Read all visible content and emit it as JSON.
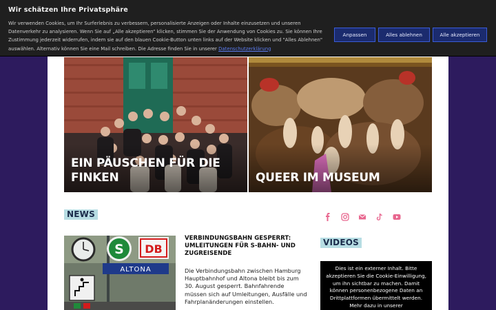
{
  "cookie_banner": {
    "title": "Wir schätzen Ihre Privatsphäre",
    "text": "Wir verwenden Cookies, um Ihr Surferlebnis zu verbessern, personalisierte Anzeigen oder Inhalte einzusetzen und unseren Datenverkehr zu analysieren. Wenn Sie auf „Alle akzeptieren“ klicken, stimmen Sie der Anwendung von Cookies zu. Sie können Ihre Zustimmung jederzeit widerrufen, indem sie auf den blauen Cookie-Button unten links auf der Website klicken und \"Alles Ablehnen\" auswählen. Alternativ können Sie eine Mail schreiben. Die Adresse finden Sie in unserer",
    "privacy_link": "Datenschutzerklärung",
    "buttons": {
      "customize": "Anpassen",
      "reject_all": "Alles ablehnen",
      "accept_all": "Alle akzeptieren"
    },
    "button_color": "#1b2b6e"
  },
  "hero": [
    {
      "title": "EIN PÄUSCHEN FÜR DIE FINKEN"
    },
    {
      "title": "QUEER IM MUSEUM"
    }
  ],
  "sections": {
    "news_label": "NEWS",
    "videos_label": "VIDEOS"
  },
  "social_icons": [
    "facebook-icon",
    "instagram-icon",
    "mail-icon",
    "tiktok-icon",
    "youtube-icon"
  ],
  "social_color": "#e8678f",
  "news": {
    "headline": "VERBINDUNGSBAHN GESPERRT: UMLEITUNGEN FÜR S-BAHN- UND ZUGREISENDE",
    "text": "Die Verbindungsbahn zwischen Hamburg Hauptbahnhof und Altona bleibt bis zum 30. August gesperrt. Bahnfahrende müssen sich auf Umleitungen, Ausfälle und Fahrplanänderungen einstellen.",
    "image_signs": {
      "s_bahn": "S",
      "db": "DB",
      "station": "ALTONA"
    }
  },
  "video_notice": "Dies ist ein externer Inhalt. Bitte akzeptieren Sie die Cookie-Einwilligung, um ihn sichtbar zu machen. Damit können personenbezogene Daten an Drittplattformen übermittelt werden. Mehr dazu in unserer",
  "colors": {
    "background": "#2d1b5e",
    "label_bg": "#b7dde3"
  }
}
